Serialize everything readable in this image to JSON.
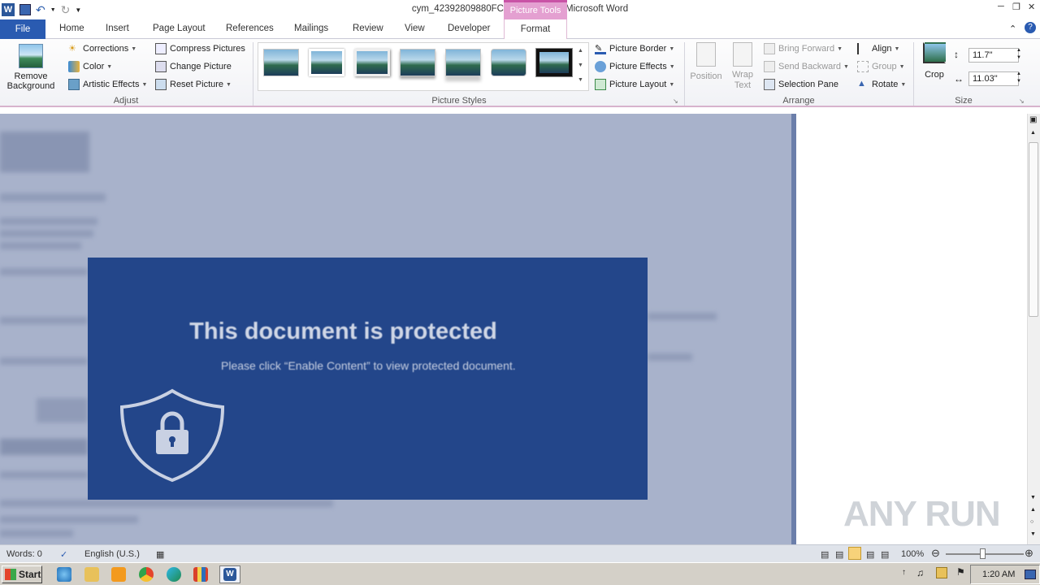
{
  "window": {
    "title": "cym_42392809880FCAE4B5C.doc - Microsoft Word",
    "contextual_group": "Picture Tools"
  },
  "tabs": [
    "Home",
    "Insert",
    "Page Layout",
    "References",
    "Mailings",
    "Review",
    "View",
    "Developer"
  ],
  "tab_file": "File",
  "tab_format": "Format",
  "ribbon": {
    "adjust": {
      "remove_background_l1": "Remove",
      "remove_background_l2": "Background",
      "corrections": "Corrections",
      "color": "Color",
      "artistic_effects": "Artistic Effects",
      "compress_pictures": "Compress Pictures",
      "change_picture": "Change Picture",
      "reset_picture": "Reset Picture",
      "label": "Adjust"
    },
    "picture_styles": {
      "picture_border": "Picture Border",
      "picture_effects": "Picture Effects",
      "picture_layout": "Picture Layout",
      "label": "Picture Styles"
    },
    "arrange": {
      "position": "Position",
      "wrap_text_l1": "Wrap",
      "wrap_text_l2": "Text",
      "bring_forward": "Bring Forward",
      "send_backward": "Send Backward",
      "selection_pane": "Selection Pane",
      "align": "Align",
      "group": "Group",
      "rotate": "Rotate",
      "label": "Arrange"
    },
    "size": {
      "crop": "Crop",
      "height": "11.7\"",
      "width": "11.03\"",
      "label": "Size"
    }
  },
  "document": {
    "banner_title": "This document is protected",
    "banner_subtitle": "Please click “Enable Content” to view protected document."
  },
  "watermark": "ANY RUN",
  "statusbar": {
    "words": "Words: 0",
    "language": "English (U.S.)",
    "zoom": "100%"
  },
  "taskbar": {
    "start": "Start",
    "clock": "1:20 AM"
  },
  "colors": {
    "file_tab": "#2a5bb1",
    "picture_tools": "#e4a0d1",
    "banner": "#23468a",
    "doc_bg": "#a8b2cb"
  }
}
